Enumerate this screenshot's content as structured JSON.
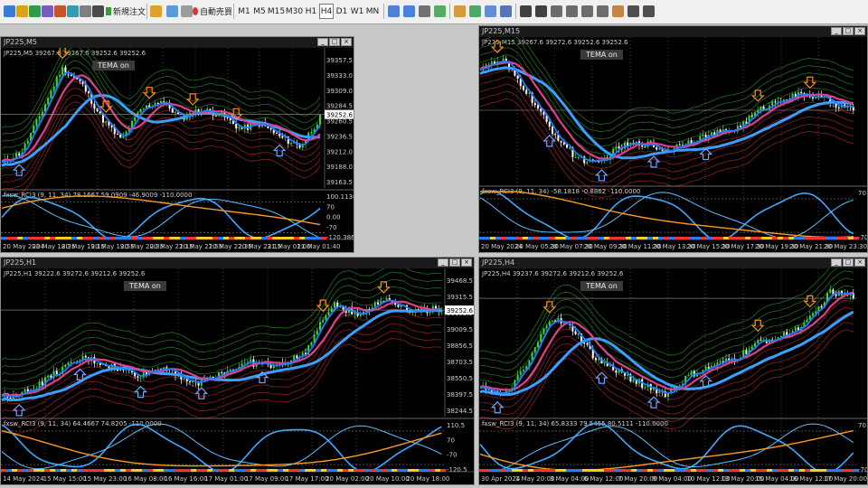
{
  "toolbar": {
    "new_order_label": "新規注文",
    "auto_trade_label": "自動売買",
    "timeframes": [
      "M1",
      "M5",
      "M15",
      "M30",
      "H1",
      "H4",
      "D1",
      "W1",
      "MN"
    ],
    "active_timeframe": "H4",
    "icons": [
      "new-chart-icon",
      "profiles-icon",
      "zoom-window-icon",
      "market-watch-icon",
      "navigator-icon",
      "terminal-icon",
      "tester-icon",
      "new-order-icon",
      "meta-editor-icon",
      "auto-trade-icon",
      "zoom-in-icon",
      "zoom-out-icon",
      "tile-icon",
      "autoscroll-icon",
      "chart-shift-icon",
      "indicators-icon",
      "periods-icon",
      "templates-icon",
      "cursor-icon",
      "crosshair-icon",
      "vertical-line-icon",
      "horizontal-line-icon",
      "trendline-icon",
      "channel-icon",
      "fibo-icon",
      "text-icon",
      "arrow-icon"
    ]
  },
  "charts": [
    {
      "id": "m5",
      "window_title": "JP225,M5",
      "info_line": "JP225,M5  39267.6 39267.6 39252.6 39252.6",
      "tema_label": "TEMA on",
      "price_ticks": [
        "39357.5",
        "39333.0",
        "39309.0",
        "39284.5",
        "39260.5",
        "39236.5",
        "39212.0",
        "39188.0",
        "39163.5"
      ],
      "current_price": "39252.6",
      "osc_label": "fxsw_RCI3 (9, 11, 34) 78.1667 59.0909 -46.9009 -110.0000",
      "osc_ticks": [
        "100.1136",
        "70",
        "0.00",
        "-70",
        "-120.3864"
      ],
      "time_labels": [
        "20 May 2024",
        "20 May 18:35",
        "20 May 19:15",
        "20 May 19:55",
        "20 May 20:35",
        "20 May 21:15",
        "20 May 21:55",
        "20 May 22:35",
        "20 May 23:15",
        "21 May 01:00",
        "21 May 01:40"
      ]
    },
    {
      "id": "m15",
      "window_title": "JP225,M15",
      "info_line": "JP225,M15  39267.6 39272.6 39252.6 39252.6",
      "tema_label": "TEMA on",
      "price_ticks": [],
      "current_price": "",
      "osc_label": "fxsw_RCI3 (9, 11, 34) -58.1818 -0.8862 -110.0000",
      "osc_ticks": [
        "70",
        "-70"
      ],
      "time_labels": [
        "20 May 2024",
        "20 May 05:30",
        "20 May 07:30",
        "20 May 09:30",
        "20 May 11:30",
        "20 May 13:30",
        "20 May 15:30",
        "20 May 17:30",
        "20 May 19:30",
        "20 May 21:30",
        "20 May 23:30"
      ]
    },
    {
      "id": "h1",
      "window_title": "JP225,H1",
      "info_line": "JP225,H1  39222.6 39272.6 39212.6 39252.6",
      "tema_label": "TEMA on",
      "price_ticks": [
        "39468.5",
        "39315.5",
        "39162.5",
        "39009.5",
        "38856.5",
        "38703.5",
        "38550.5",
        "38397.5",
        "38244.5"
      ],
      "current_price": "39252.6",
      "osc_label": "fxsw_RCI3 (9, 11, 34) 64.4667 74.8205 -110.0000",
      "osc_ticks": [
        "110.5",
        "70",
        "-70",
        "-120.5"
      ],
      "time_labels": [
        "14 May 2024",
        "15 May 15:00",
        "15 May 23:00",
        "16 May 08:00",
        "16 May 16:00",
        "17 May 01:00",
        "17 May 09:00",
        "17 May 17:00",
        "20 May 02:00",
        "20 May 10:00",
        "20 May 18:00"
      ]
    },
    {
      "id": "h4",
      "window_title": "JP225,H4",
      "info_line": "JP225,H4  39237.6 39272.6 39212.6 39252.6",
      "tema_label": "TEMA on",
      "price_ticks": [],
      "current_price": "",
      "osc_label": "fxsw_RCI3 (9, 11, 34) 65.8333 79.5455 80.5111 -110.0000",
      "osc_ticks": [
        "70",
        "-70"
      ],
      "time_labels": [
        "30 Apr 2024",
        "1 May 20:00",
        "3 May 04:00",
        "6 May 12:00",
        "7 May 20:00",
        "9 May 04:00",
        "10 May 12:00",
        "13 May 20:00",
        "15 May 04:00",
        "16 May 12:00",
        "17 May 20:00"
      ]
    }
  ],
  "colors": {
    "chart_bg": "#000000",
    "bull_candle": "#3fd43f",
    "bear_candle": "#ffffff",
    "ma_fast_up": "#1e7bff",
    "ma_fast_down": "#ff3b3b",
    "ma_mid": "#e0408a",
    "ma_slow": "#3aa0ff",
    "band_green": "#1f6d1f",
    "band_red": "#8a1f1f",
    "rci_short": "#3fa9ff",
    "rci_long": "#ff9a1f",
    "arrow_orange": "#ff8c1a",
    "arrow_blue": "#6aa6ff",
    "tema_box": "#3a3a3a"
  }
}
